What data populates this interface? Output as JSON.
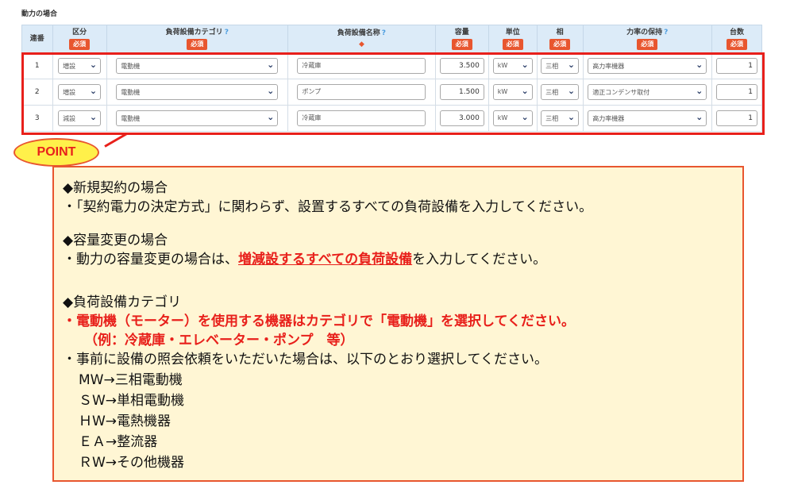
{
  "section_title": "動力の場合",
  "headers": {
    "no": "連番",
    "kubun": "区分",
    "category": "負荷設備カテゴリ",
    "name": "負荷設備名称",
    "capacity": "容量",
    "unit": "単位",
    "phase": "相",
    "power_factor": "力率の保持",
    "count": "台数",
    "help": "?",
    "required": "必須",
    "diamond": "◆"
  },
  "rows": [
    {
      "no": "1",
      "kubun": "増設",
      "category": "電動機",
      "name": "冷蔵庫",
      "capacity": "3.500",
      "unit": "kW",
      "phase": "三相",
      "power_factor": "高力率機器",
      "count": "1"
    },
    {
      "no": "2",
      "kubun": "増設",
      "category": "電動機",
      "name": "ポンプ",
      "capacity": "1.500",
      "unit": "kW",
      "phase": "三相",
      "power_factor": "適正コンデンサ取付",
      "count": "1"
    },
    {
      "no": "3",
      "kubun": "減設",
      "category": "電動機",
      "name": "冷蔵庫",
      "capacity": "3.000",
      "unit": "kW",
      "phase": "三相",
      "power_factor": "高力率機器",
      "count": "1"
    }
  ],
  "point_label": "POINT",
  "note": {
    "h1": "◆新規契約の場合",
    "l1": "・「契約電力の決定方式」に関わらず、設置するすべての負荷設備を入力してください。",
    "h2": "◆容量変更の場合",
    "l2_pre": "・動力の容量変更の場合は、",
    "l2_red": "増減設するすべての負荷設備",
    "l2_post": "を入力してください。",
    "h3": "◆負荷設備カテゴリ",
    "l3": "・電動機（モーター）を使用する機器はカテゴリで「電動機」を選択してください。",
    "l4": "（例：冷蔵庫・エレベーター・ポンプ　等）",
    "l5": "・事前に設備の照会依頼をいただいた場合は、以下のとおり選択してください。",
    "codes": [
      "MW→三相電動機",
      "ＳW→単相電動機",
      "ＨW→電熱機器",
      "ＥＡ→整流器",
      "ＲW→その他機器"
    ]
  },
  "colors": {
    "accent_red": "#e8201b",
    "required_badge": "#e8562f",
    "header_bg": "#dcebf8",
    "note_bg": "#fff6d4",
    "bubble": "#fff04a"
  }
}
